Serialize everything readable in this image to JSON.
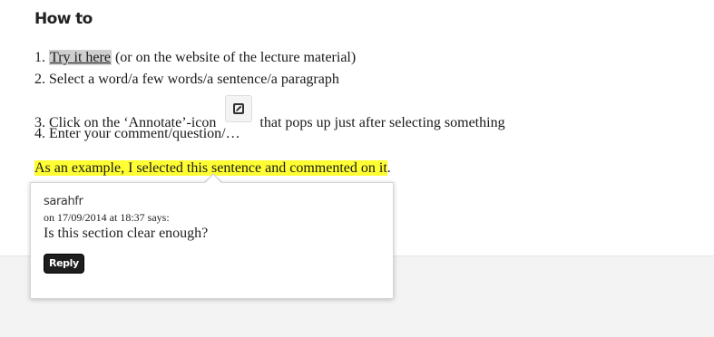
{
  "heading": "How to",
  "steps": {
    "s1_num": "1. ",
    "s1_link": "Try it here",
    "s1_rest": " (or on the website of the lecture material)",
    "s2": "2. Select a word/a few words/a sentence/a paragraph",
    "s3_before": "3. Click on the  ‘Annotate’-icon",
    "s3_after": "that pops up just after selecting something",
    "s4": "4. Enter your comment/question/…"
  },
  "example": {
    "highlighted": "As an example, I selected this sentence and commented on it",
    "tail": "."
  },
  "annotation": {
    "author": "sarahfr",
    "meta": "on 17/09/2014 at 18:37 says:",
    "comment": "Is this section clear enough?",
    "reply_label": "Reply"
  },
  "icons": {
    "annotate": "edit-square-icon"
  },
  "colors": {
    "highlight": "#ffff33",
    "link_bg": "#cfcfcf",
    "reply_bg": "#1e1e1e"
  }
}
